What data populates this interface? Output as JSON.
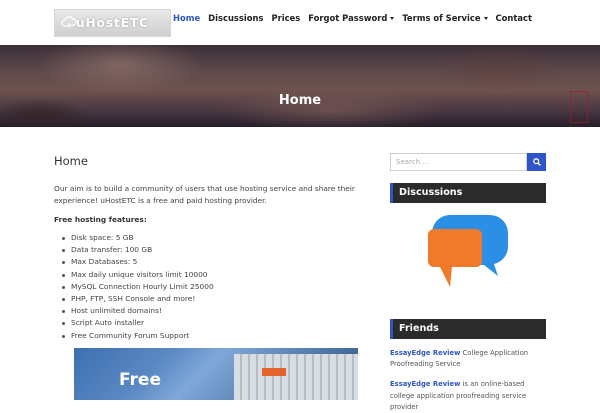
{
  "header": {
    "logo_text": "uHostETC",
    "nav": [
      {
        "label": "Home",
        "active": true
      },
      {
        "label": "Discussions"
      },
      {
        "label": "Prices"
      },
      {
        "label": "Forgot Password",
        "dropdown": true
      },
      {
        "label": "Terms of Service",
        "dropdown": true
      },
      {
        "label": "Contact"
      }
    ]
  },
  "hero": {
    "title": "Home"
  },
  "main": {
    "title": "Home",
    "intro": "Our aim is to build a community of users that use hosting service and share their experience! uHostETC is a free and paid hosting provider.",
    "features_title": "Free hosting features:",
    "features": [
      "Disk space: 5 GB",
      "Data transfer: 100 GB",
      "Max Databases: 5",
      "Max daily unique visitors limit 10000",
      "MySQL Connection Hourly Limit 25000",
      "PHP, FTP, SSH Console and more!",
      "Host unlimited domains!",
      "Script Auto installer",
      "Free Community Forum Support"
    ],
    "promo_text": "Free"
  },
  "sidebar": {
    "search_placeholder": "Search ...",
    "discussions_title": "Discussions",
    "friends_title": "Friends",
    "friends": [
      {
        "link": "EssayEdge Review",
        "text": " College Application Proofreading Service"
      },
      {
        "link": "EssayEdge Review",
        "text": " is an online-based college application proofreading service provider"
      }
    ]
  },
  "colors": {
    "accent": "#2f55c8",
    "widget_bg": "#2b2b2b"
  }
}
